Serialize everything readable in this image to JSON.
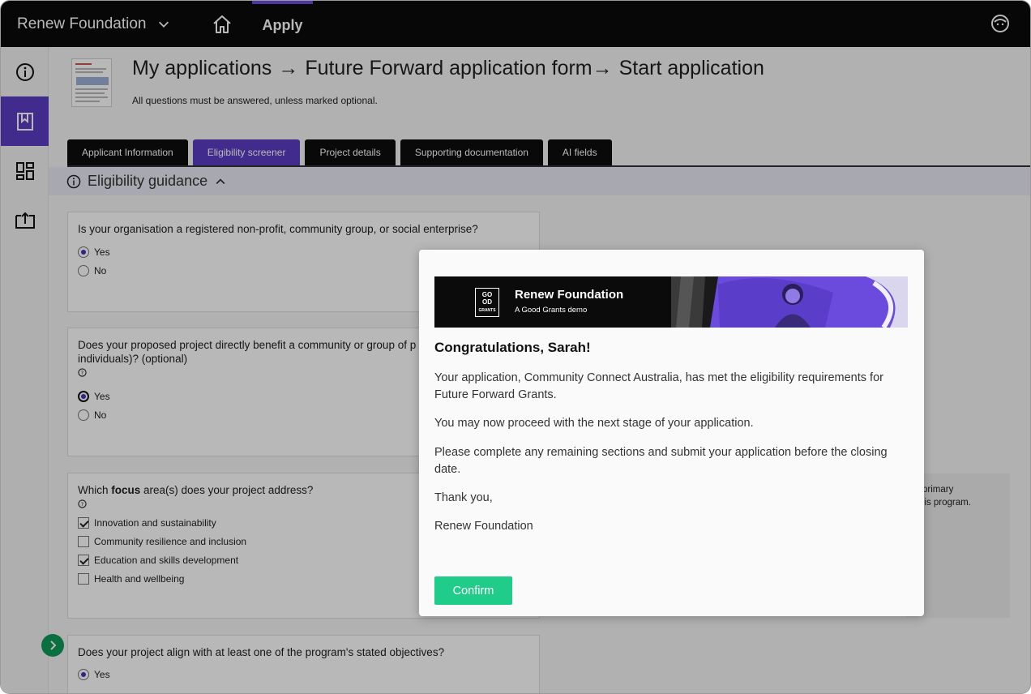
{
  "topbar": {
    "org_name": "Renew Foundation",
    "apply_label": "Apply"
  },
  "page": {
    "breadcrumb": [
      "My applications",
      "Future Forward application form",
      "Start application"
    ],
    "subtitle": "All questions must be answered, unless marked optional."
  },
  "tabs": [
    {
      "label": "Applicant Information",
      "active": false
    },
    {
      "label": "Eligibility screener",
      "active": true
    },
    {
      "label": "Project details",
      "active": false
    },
    {
      "label": "Supporting documentation",
      "active": false
    },
    {
      "label": "AI fields",
      "active": false
    }
  ],
  "guidance": {
    "label": "Eligibility guidance"
  },
  "questions": {
    "q1": {
      "text": "Is your organisation a registered non-profit, community group, or social enterprise?",
      "options": [
        "Yes",
        "No"
      ],
      "selected": "Yes"
    },
    "q2": {
      "text_line1": "Does your proposed project directly benefit a community or group of p",
      "text_line2": "individuals)? (optional)",
      "options": [
        "Yes",
        "No"
      ],
      "selected": "Yes"
    },
    "q3": {
      "prefix": "Which ",
      "bold": "focus",
      "suffix": " area(s) does your project address?",
      "options": [
        "Innovation and sustainability",
        "Community resilience and inclusion",
        "Education and skills development",
        "Health and wellbeing"
      ],
      "checked": [
        true,
        false,
        true,
        false
      ]
    },
    "q4": {
      "text": "Does your project align with at least one of the program's stated objectives?",
      "options": [
        "Yes"
      ],
      "selected": "Yes"
    }
  },
  "side_note": {
    "line1": "primary",
    "line2": "his program."
  },
  "modal": {
    "banner_logo_top": "GO",
    "banner_logo_mid": "OD",
    "banner_logo_bottom": "GRANTS",
    "banner_name": "Renew Foundation",
    "banner_sub": "A Good Grants demo",
    "title": "Congratulations, Sarah!",
    "para1": "Your application, Community Connect Australia, has met the eligibility requirements for Future Forward Grants.",
    "para2": "You may now proceed with the next stage of your application.",
    "para3": "Please complete any remaining sections and submit your application before the closing date.",
    "para4": "Thank you,",
    "para5": "Renew Foundation",
    "confirm_label": "Confirm"
  },
  "colors": {
    "brand_purple": "#5b3cc4",
    "confirm_green": "#1fcc8a",
    "topbar_black": "#0a0a0a"
  }
}
